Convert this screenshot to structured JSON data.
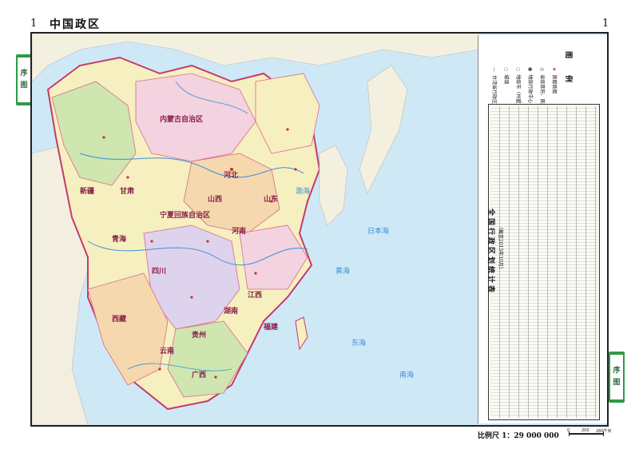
{
  "header": {
    "left_page_number": "1",
    "title": "中国政区",
    "right_page_number": "1"
  },
  "side_tabs": {
    "left": [
      "序",
      "图"
    ],
    "right": [
      "序",
      "图"
    ]
  },
  "legend": {
    "title": "图　例",
    "items": [
      {
        "symbol": "★",
        "label": "首都首都"
      },
      {
        "symbol": "◎",
        "label": "省级首府、首府"
      },
      {
        "symbol": "●",
        "label": "地级行政中心"
      },
      {
        "symbol": "○",
        "label": "地级市（州盟直辖县级市）"
      },
      {
        "symbol": "○",
        "label": "城镇"
      },
      {
        "symbol": "—",
        "label": "台湾省行政区划资料暂缺"
      }
    ]
  },
  "stats_table": {
    "title": "全国行政区划统计表",
    "subtitle": "（截至2015年10月）"
  },
  "scale": {
    "label": "比例尺 1：29 000 000",
    "ticks": [
      "0",
      "200",
      "280千米"
    ]
  },
  "map": {
    "region_labels": [
      "内蒙古自治区",
      "宁夏回族自治区",
      "甘肃",
      "青海",
      "四川",
      "新疆",
      "西藏",
      "云南",
      "广西",
      "贵州",
      "湖南",
      "江西",
      "福建",
      "河北",
      "山西",
      "山东",
      "河南"
    ],
    "sea_labels": [
      "日本海",
      "黄海",
      "东海",
      "南海",
      "渤海"
    ],
    "colors": {
      "sea": "#cfe8f6",
      "land_yellow": "#f6efc0",
      "land_green": "#cfe6b0",
      "land_pink": "#f3d3df",
      "land_purple": "#ded3ec",
      "land_orange": "#f5d8ae",
      "border": "#c43a6e",
      "river": "#3b8fd9"
    }
  }
}
